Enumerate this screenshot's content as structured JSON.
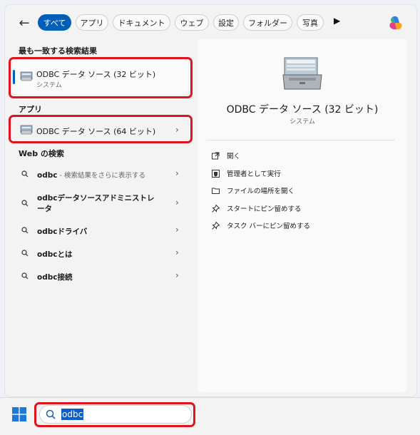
{
  "filters": {
    "back": "←",
    "chips": [
      "すべて",
      "アプリ",
      "ドキュメント",
      "ウェブ",
      "設定",
      "フォルダー",
      "写真"
    ],
    "more": "▶"
  },
  "best_match": {
    "heading": "最も一致する検索結果",
    "title": "ODBC データ ソース (32 ビット)",
    "subtitle": "システム"
  },
  "apps": {
    "heading": "アプリ",
    "items": [
      {
        "title": "ODBC データ ソース (64 ビット)",
        "chevron": "›"
      }
    ]
  },
  "web": {
    "heading": "Web の検索",
    "items": [
      {
        "bold": "odbc",
        "dim": " - 検索結果をさらに表示する",
        "chevron": "›"
      },
      {
        "bold": "odbcデータソースアドミニストレ",
        "line2": "ータ",
        "dim": "",
        "chevron": "›"
      },
      {
        "bold": "odbcドライバ",
        "dim": "",
        "chevron": "›"
      },
      {
        "bold": "odbcとは",
        "dim": "",
        "chevron": "›"
      },
      {
        "bold": "odbc接続",
        "dim": "",
        "chevron": "›"
      }
    ]
  },
  "detail": {
    "title": "ODBC データ ソース (32 ビット)",
    "subtitle": "システム",
    "actions": [
      {
        "label": "開く",
        "icon": "open-icon"
      },
      {
        "label": "管理者として実行",
        "icon": "shield-icon"
      },
      {
        "label": "ファイルの場所を開く",
        "icon": "folder-icon"
      },
      {
        "label": "スタートにピン留めする",
        "icon": "pin-icon"
      },
      {
        "label": "タスク バーにピン留めする",
        "icon": "pin-icon"
      }
    ]
  },
  "taskbar": {
    "search_value": "odbc"
  },
  "colors": {
    "accent": "#005fb8",
    "highlight": "#e0141e"
  }
}
